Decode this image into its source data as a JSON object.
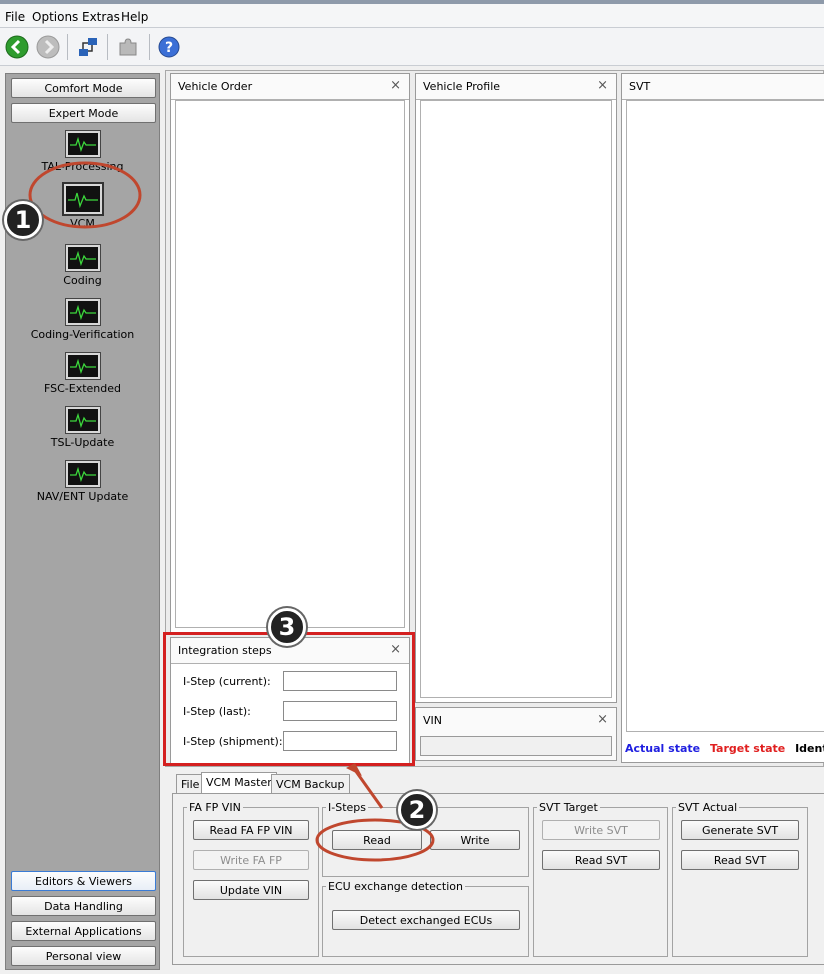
{
  "menubar": {
    "items": [
      "File",
      "Options",
      "Extras",
      "Help"
    ]
  },
  "toolbar": {
    "icons": [
      "back-icon",
      "forward-icon",
      "connection-icon",
      "puzzle-icon",
      "help-icon"
    ]
  },
  "left_panel": {
    "comfort_mode": "Comfort Mode",
    "expert_mode": "Expert Mode",
    "nav_items": [
      "TAL-Processing",
      "VCM",
      "Coding",
      "Coding-Verification",
      "FSC-Extended",
      "TSL-Update",
      "NAV/ENT Update"
    ],
    "bottom_buttons": [
      "Editors & Viewers",
      "Data Handling",
      "External Applications",
      "Personal view"
    ]
  },
  "panels": {
    "vehicle_order": "Vehicle Order",
    "vehicle_profile": "Vehicle Profile",
    "svt": "SVT",
    "vin": "VIN",
    "integration_steps": "Integration steps",
    "close_symbol": "×"
  },
  "integration": {
    "current_label": "I-Step (current):",
    "last_label": "I-Step (last):",
    "shipment_label": "I-Step (shipment):",
    "current_value": "",
    "last_value": "",
    "shipment_value": ""
  },
  "legend": {
    "actual": "Actual state",
    "target": "Target state",
    "identical": "Identical",
    "actual_color": "#1f1fe0",
    "target_color": "#e01f1f"
  },
  "tabs": [
    "File",
    "VCM Master",
    "VCM Backup"
  ],
  "active_tab": "VCM Master",
  "groups": {
    "fa_fp_vin": {
      "title": "FA FP VIN",
      "read": "Read FA FP VIN",
      "write": "Write FA FP",
      "update": "Update VIN"
    },
    "i_steps": {
      "title": "I-Steps",
      "read": "Read",
      "write": "Write"
    },
    "ecu_exchange": {
      "title": "ECU exchange detection",
      "detect": "Detect exchanged ECUs"
    },
    "svt_target": {
      "title": "SVT Target",
      "write": "Write SVT",
      "read": "Read SVT"
    },
    "svt_actual": {
      "title": "SVT Actual",
      "generate": "Generate SVT",
      "read": "Read SVT"
    }
  },
  "callouts": [
    "1",
    "2",
    "3"
  ],
  "annotation_colors": {
    "red": "#d42020",
    "ellipse": "#c0472e"
  }
}
